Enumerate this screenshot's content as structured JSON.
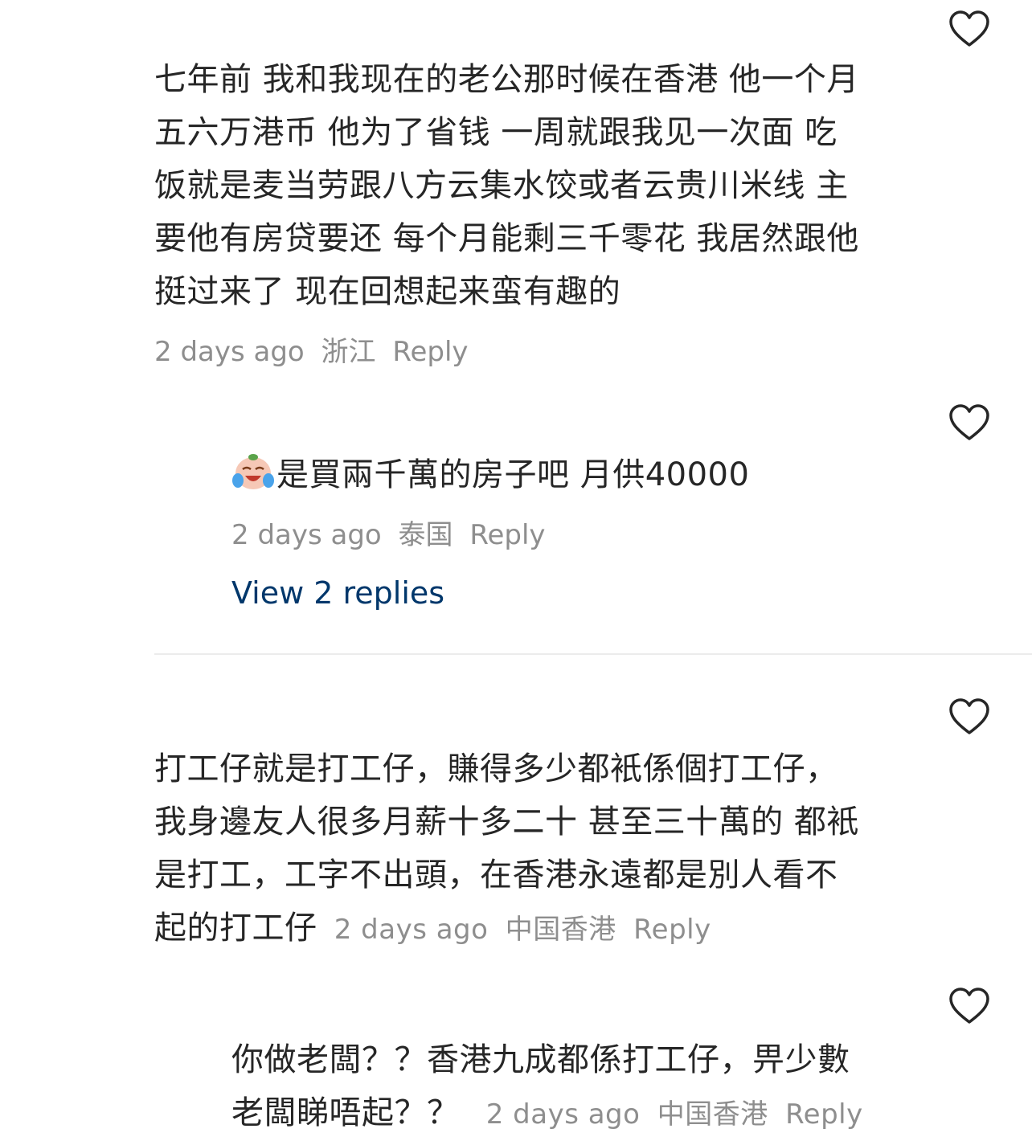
{
  "comments": [
    {
      "lines": [
        "七年前 我和我现在的老公那时候在香港 他一个月",
        "五六万港币 他为了省钱 一周就跟我见一次面 吃",
        "饭就是麦当劳跟八方云集水饺或者云贵川米线 主",
        "要他有房贷要还 每个月能剩三千零花 我居然跟他",
        "挺过来了  现在回想起来蛮有趣的"
      ],
      "time": "2 days ago",
      "location": "浙江",
      "reply": "Reply"
    },
    {
      "emoji": "crying-laughing-face-icon",
      "text": "是買兩千萬的房子吧 月供40000",
      "time": "2 days ago",
      "location": "泰国",
      "reply": "Reply",
      "view_replies": "View 2 replies"
    },
    {
      "lines": [
        "打工仔就是打工仔，賺得多少都衹係個打工仔，",
        "我身邊友人很多月薪十多二十 甚至三十萬的 都衹",
        "是打工，工字不出頭，在香港永遠都是別人看不",
        "起的打工仔"
      ],
      "time": "2 days ago",
      "location": "中国香港",
      "reply": "Reply"
    },
    {
      "lines": [
        "你做老闆？？香港九成都係打工仔，畀少數",
        "老闆睇唔起？？"
      ],
      "time": "2 days ago",
      "location": "中国香港",
      "reply": "Reply"
    }
  ]
}
